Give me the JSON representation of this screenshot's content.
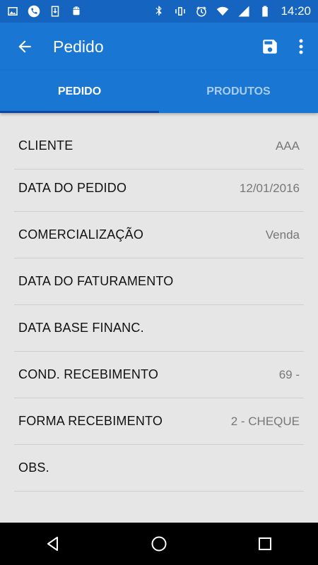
{
  "status_bar": {
    "time": "14:20",
    "left_icons": [
      "image-icon",
      "phone-icon",
      "download-icon",
      "android-icon"
    ],
    "right_icons": [
      "bluetooth-icon",
      "vibrate-icon",
      "alarm-icon",
      "wifi-icon",
      "signal-icon",
      "battery-icon"
    ]
  },
  "app_bar": {
    "title": "Pedido",
    "back_icon": "arrow-back-icon",
    "save_icon": "save-icon",
    "more_icon": "more-vert-icon"
  },
  "tabs": [
    {
      "label": "PEDIDO",
      "active": true
    },
    {
      "label": "PRODUTOS",
      "active": false
    }
  ],
  "fields": [
    {
      "label": "CLIENTE",
      "value": "AAA"
    },
    {
      "label": "DATA DO PEDIDO",
      "value": "12/01/2016"
    },
    {
      "label": "COMERCIALIZAÇÃO",
      "value": "Venda"
    },
    {
      "label": "DATA DO FATURAMENTO",
      "value": ""
    },
    {
      "label": "DATA BASE FINANC.",
      "value": ""
    },
    {
      "label": "COND. RECEBIMENTO",
      "value": "69 -"
    },
    {
      "label": "FORMA RECEBIMENTO",
      "value": "2 - CHEQUE"
    },
    {
      "label": "OBS.",
      "value": ""
    }
  ],
  "colors": {
    "status_bar": "#1565c0",
    "app_bar": "#1976d2",
    "tab_indicator": "#0d47a1",
    "background": "#e6e6e6"
  },
  "nav_bar": {
    "icons": [
      "back-triangle-icon",
      "home-circle-icon",
      "recents-square-icon"
    ]
  }
}
